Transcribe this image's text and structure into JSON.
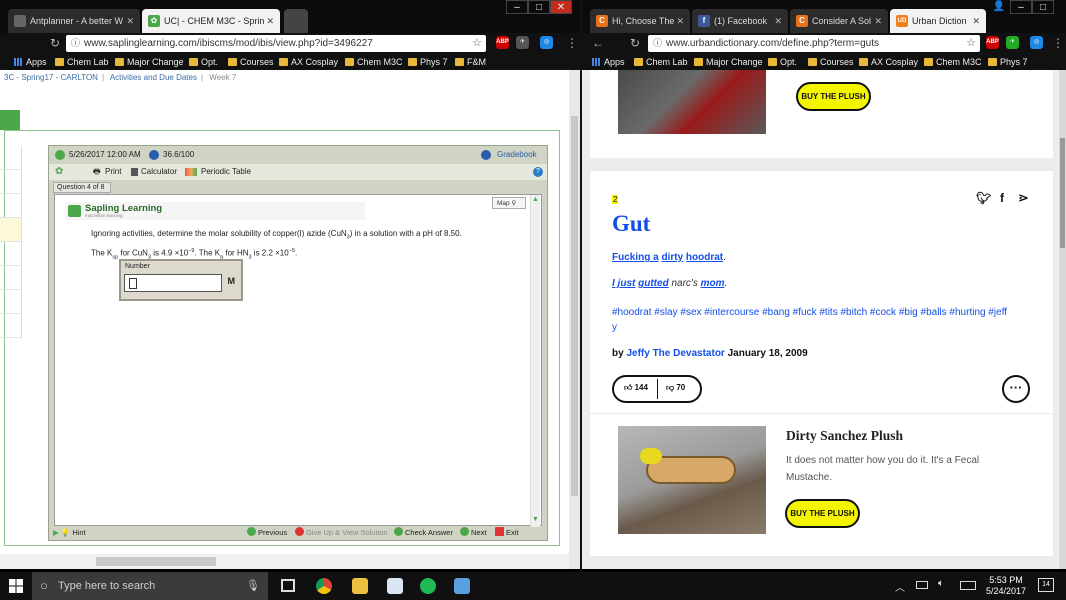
{
  "left_window": {
    "tabs": [
      {
        "title": "Antplanner - A better W",
        "favicon": "page-icon",
        "color": "#666666"
      },
      {
        "title": "UC| - CHEM M3C - Sprin",
        "favicon": "sapling-icon",
        "color": "#4aa84a"
      },
      {
        "title": "",
        "favicon": "new-tab",
        "color": "#444444"
      }
    ],
    "url": "www.saplinglearning.com/ibiscms/mod/ibis/view.php?id=3496227",
    "bookmarks": [
      "Apps",
      "Chem Lab",
      "Major Change",
      "Opt.",
      "Courses",
      "AX Cosplay",
      "Chem M3C",
      "Phys 7",
      "F&M"
    ]
  },
  "right_window": {
    "tabs": [
      {
        "title": "Hi, Choose The",
        "favicon": "C",
        "color": "#e8711c"
      },
      {
        "title": "(1) Facebook",
        "favicon": "f",
        "color": "#3b5998"
      },
      {
        "title": "Consider A Sol",
        "favicon": "C",
        "color": "#e8711c"
      },
      {
        "title": "Urban Diction",
        "favicon": "UD",
        "color": "#f08019"
      }
    ],
    "url": "www.urbandictionary.com/define.php?term=guts",
    "bookmarks": [
      "Apps",
      "Chem Lab",
      "Major Change",
      "Opt.",
      "Courses",
      "AX Cosplay",
      "Chem M3C",
      "Phys 7"
    ]
  },
  "sapling": {
    "breadcrumb": [
      "3C - Spring17 - CARLTON",
      "Activities and Due Dates",
      "Week 7"
    ],
    "date": "5/26/2017 12:00 AM",
    "score": "36.6/100",
    "gradebook": "Gradebook",
    "toolbar": {
      "print": "Print",
      "calculator": "Calculator",
      "periodic": "Periodic Table"
    },
    "question_tab": "Question 4 of 8",
    "logo_text": "Sapling Learning",
    "logo_sub": "macmillan learning",
    "map_label": "Map",
    "question": {
      "line1_a": "Ignoring activities, determine the molar solubility of copper(I) azide (CuN",
      "line1_sub": "3",
      "line1_b": ") in a solution with a pH of 8.50.",
      "l2_a": "The K",
      "l2_sub1": "sp",
      "l2_b": " for CuN",
      "l2_sub2": "3",
      "l2_c": " is 4.9 ×10",
      "l2_sup1": "−9",
      "l2_d": ". The K",
      "l2_sub3": "a",
      "l2_e": " for HN",
      "l2_sub4": "3",
      "l2_f": " is 2.2 ×10",
      "l2_sup2": "−5",
      "l2_g": "."
    },
    "number_label": "Number",
    "unit": "M",
    "hint": "Hint",
    "nav": {
      "previous": "Previous",
      "giveup": "Give Up & View Solution",
      "check": "Check Answer",
      "next": "Next",
      "exit": "Exit"
    }
  },
  "ud": {
    "buy_label": "BUY THE PLUSH",
    "rank": "2",
    "word": "Gut",
    "meaning_words": [
      "Fucking a",
      "dirty",
      "hoodrat",
      "."
    ],
    "example_a": "I just",
    "example_b": "gutted",
    "example_c": "narc's",
    "example_d": "mom",
    "tags": "#hoodrat #slay #sex #intercourse #bang #fuck #tits #bitch #cock #big #balls #hurting #jeff",
    "tags_tail": "y",
    "by_prefix": "by",
    "author": "Jeffy The Devastator",
    "date": "January 18, 2009",
    "upvotes": "144",
    "downvotes": "70",
    "ad_title": "Dirty Sanchez Plush",
    "ad_desc": "It does not matter how you do it. It's a Fecal Mustache.",
    "ad_buy": "BUY THE PLUSH"
  },
  "taskbar": {
    "search_placeholder": "Type here to search",
    "time": "5:53 PM",
    "date": "5/24/2017",
    "notifications": "14"
  }
}
